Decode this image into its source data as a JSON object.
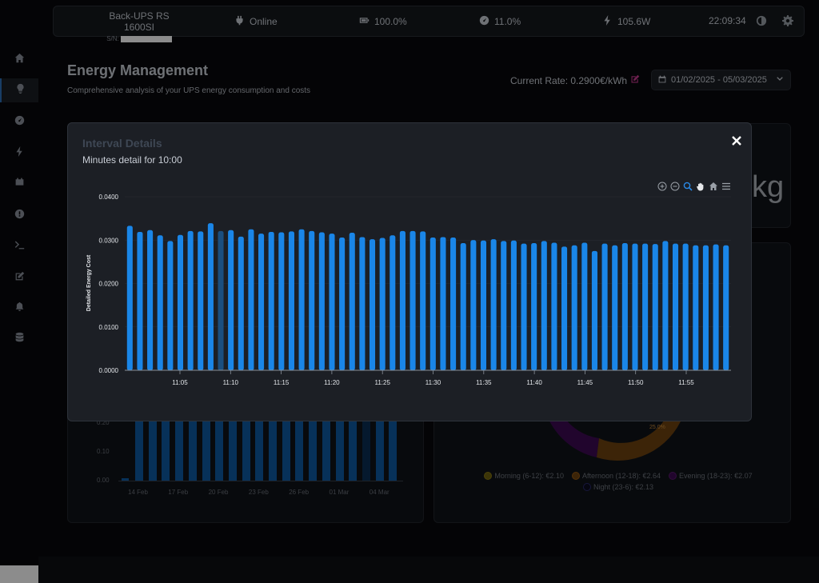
{
  "topbar": {
    "device_name": "Back-UPS RS 1600SI",
    "sn_label": "S/N:",
    "status": "Online",
    "battery": "100.0%",
    "load": "11.0%",
    "power": "105.6W",
    "time": "22:09:34"
  },
  "sidebar": {
    "items": [
      {
        "icon": "home-icon"
      },
      {
        "icon": "lightbulb-icon",
        "active": true
      },
      {
        "icon": "gauge-icon"
      },
      {
        "icon": "bolt-icon"
      },
      {
        "icon": "battery-icon"
      },
      {
        "icon": "info-icon"
      },
      {
        "icon": "terminal-icon"
      },
      {
        "icon": "edit-icon"
      },
      {
        "icon": "bell-icon"
      },
      {
        "icon": "database-icon"
      }
    ]
  },
  "page": {
    "title": "Energy Management",
    "subtitle": "Comprehensive analysis of your UPS energy consumption and costs",
    "rate_label": "Current Rate: 0.2900€/kWh",
    "date_range": "01/02/2025 - 05/03/2025",
    "accent_color": "#c63a8e"
  },
  "background": {
    "kg_fragment": "kg",
    "daily_ticks_y": [
      "0.20",
      "0.10",
      "0.00"
    ],
    "daily_ticks_x": [
      "14 Feb",
      "17 Feb",
      "20 Feb",
      "23 Feb",
      "26 Feb",
      "01 Mar",
      "04 Mar"
    ],
    "donut_label": "25.0%",
    "legend": [
      {
        "label": "Morning (6-12): €2.10",
        "color": "#8a7a12"
      },
      {
        "label": "Afternoon (12-18): €2.64",
        "color": "#9a5a10"
      },
      {
        "label": "Evening (18-23): €2.07",
        "color": "#5a1a6e"
      },
      {
        "label": "Night (23-6): €2.13",
        "color": "#2a2a6e"
      }
    ]
  },
  "modal": {
    "title": "Interval Details",
    "subtitle": "Minutes detail for 10:00",
    "tools": [
      "zoom-in-icon",
      "zoom-out-icon",
      "zoom-select-icon",
      "pan-icon",
      "reset-home-icon",
      "menu-icon"
    ]
  },
  "chart_data": {
    "type": "bar",
    "ylabel": "Detailed Energy Cost",
    "ylim": [
      0,
      0.04
    ],
    "yticks": [
      "0.0000",
      "0.0100",
      "0.0200",
      "0.0300",
      "0.0400"
    ],
    "xticks": [
      "11:05",
      "11:10",
      "11:15",
      "11:20",
      "11:25",
      "11:30",
      "11:35",
      "11:40",
      "11:45",
      "11:50",
      "11:55"
    ],
    "bar_color": "#1a86e8",
    "highlight_color": "#1b4f80",
    "highlight_index": 9,
    "values": [
      0.0333,
      0.0319,
      0.0323,
      0.0311,
      0.0298,
      0.0312,
      0.0321,
      0.032,
      0.0339,
      0.0321,
      0.0323,
      0.0308,
      0.0325,
      0.0315,
      0.0319,
      0.0318,
      0.032,
      0.0325,
      0.0321,
      0.0318,
      0.0315,
      0.0306,
      0.0317,
      0.0307,
      0.0302,
      0.0305,
      0.0311,
      0.0321,
      0.0321,
      0.032,
      0.0306,
      0.0307,
      0.0306,
      0.0293,
      0.03,
      0.0299,
      0.0302,
      0.0298,
      0.0299,
      0.0292,
      0.0293,
      0.0298,
      0.0294,
      0.0285,
      0.0288,
      0.0294,
      0.0275,
      0.0292,
      0.0288,
      0.0293,
      0.0292,
      0.0292,
      0.0291,
      0.0298,
      0.0292,
      0.0292,
      0.0288,
      0.0288,
      0.029,
      0.0288
    ]
  }
}
